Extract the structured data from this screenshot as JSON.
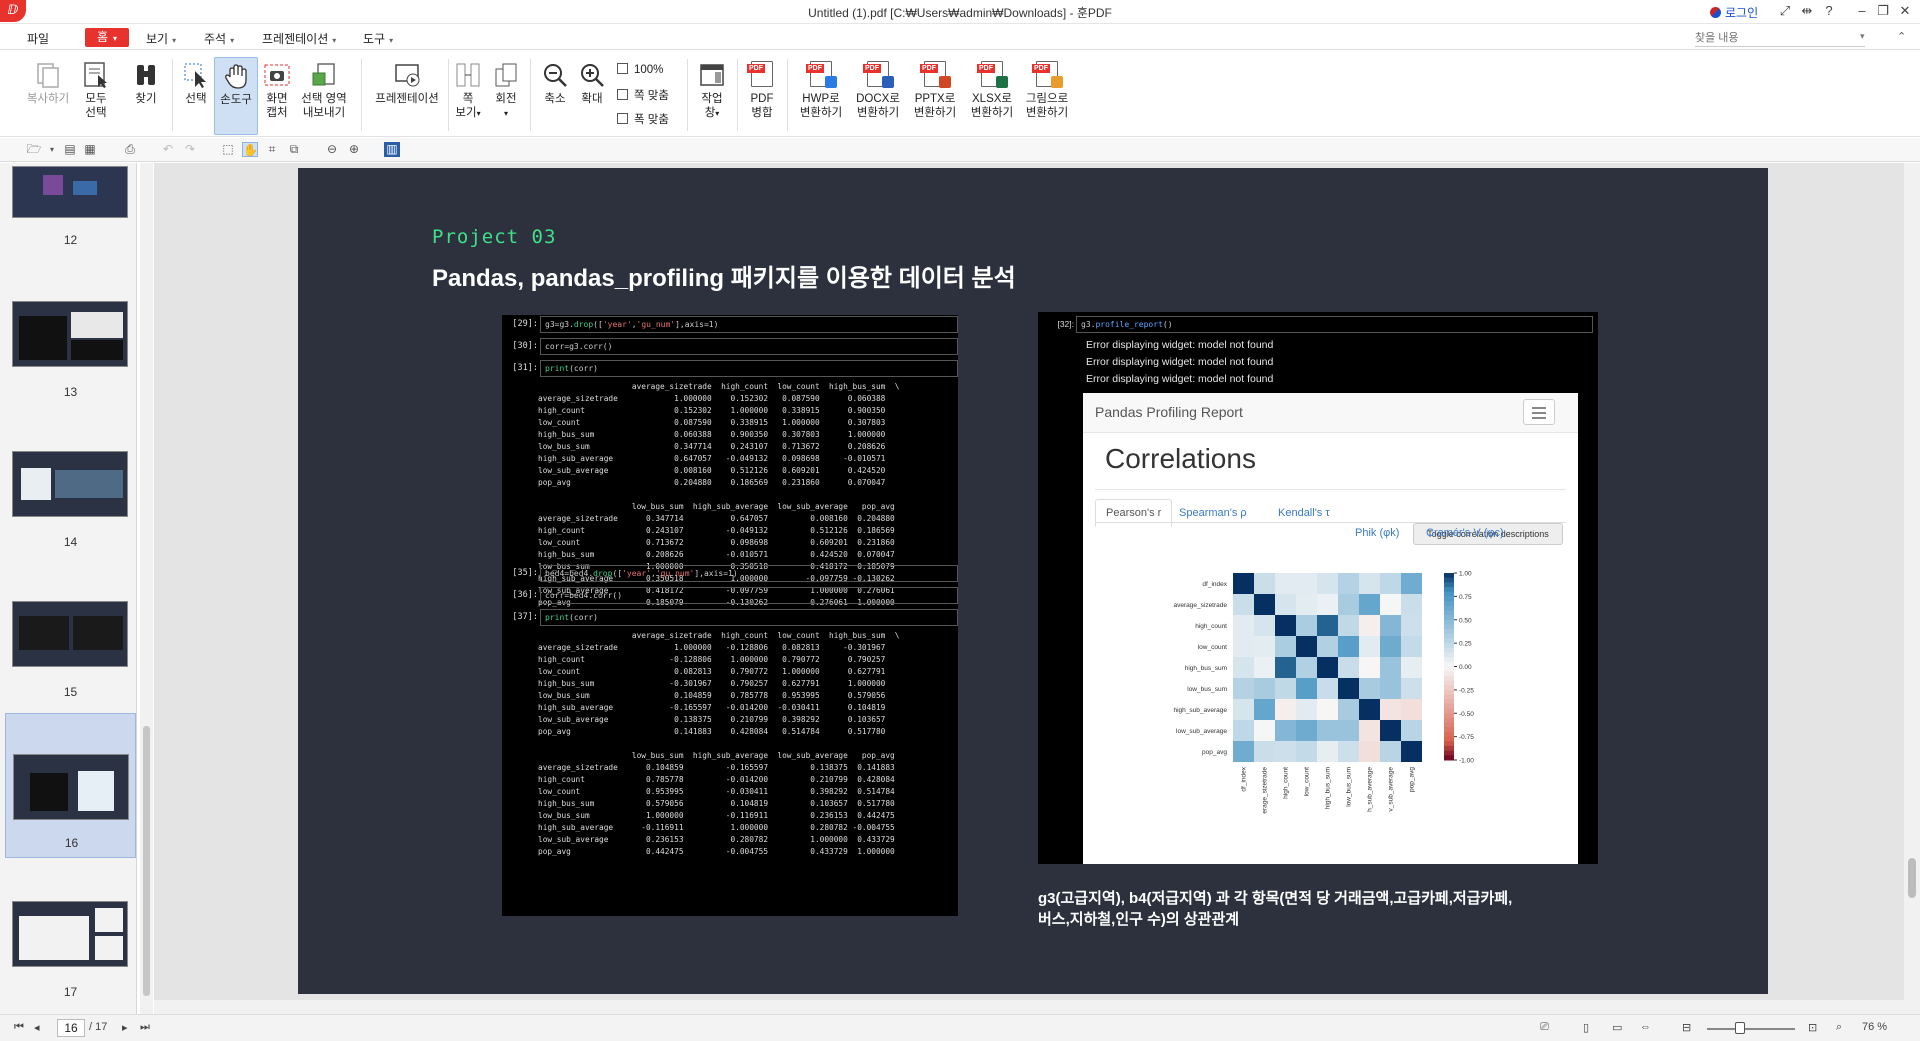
{
  "window": {
    "title": "Untitled (1).pdf [C:₩Users₩admin₩Downloads] - 훈PDF",
    "login": "로그인"
  },
  "menu": {
    "file": "파일",
    "home": "홈",
    "view": "보기",
    "annotation": "주석",
    "presentation": "프레젠테이션",
    "tools": "도구",
    "search_placeholder": "찾을 내용"
  },
  "ribbon": {
    "copy": "복사하기",
    "select_all_1": "모두",
    "select_all_2": "선택",
    "find": "찾기",
    "select": "선택",
    "hand": "손도구",
    "capture_1": "화면",
    "capture_2": "캡처",
    "export_area_1": "선택 영역",
    "export_area_2": "내보내기",
    "presentation": "프레젠테이션",
    "page_view_1": "쪽",
    "page_view_2": "보기",
    "rotate_1": "회전",
    "zoom_out": "축소",
    "zoom_in": "확대",
    "zoom_100": "100%",
    "fit_page": "쪽 맞춤",
    "fit_width": "폭 맞춤",
    "window_1": "작업",
    "window_2": "창",
    "merge_1": "PDF",
    "merge_2": "병합",
    "to_hwp_1": "HWP로",
    "to_hwp_2": "변환하기",
    "to_docx_1": "DOCX로",
    "to_docx_2": "변환하기",
    "to_pptx_1": "PPTX로",
    "to_pptx_2": "변환하기",
    "to_xlsx_1": "XLSX로",
    "to_xlsx_2": "변환하기",
    "to_img_1": "그림으로",
    "to_img_2": "변환하기"
  },
  "sidebar": {
    "pages": [
      "12",
      "13",
      "14",
      "15",
      "16",
      "17"
    ],
    "selected": "16"
  },
  "slide": {
    "project": "Project 03",
    "heading": "Pandas, pandas_profiling 패키지를 이용한 데이터 분석",
    "caption_1": "g3(고급지역), b4(저급지역) 과 각 항목(면적 당 거래금액,고급카페,저급카페,",
    "caption_2": "버스,지하철,인구 수)의 상관관계"
  },
  "notebook_left": {
    "c29_prompt": "[29]:",
    "c29_a": "g3=g3.",
    "c29_b": "drop",
    "c29_c": "([",
    "c29_d": "'year'",
    "c29_e": ",",
    "c29_f": "'gu_num'",
    "c29_g": "],axis=1)",
    "c30_prompt": "[30]:",
    "c30_code": "corr=g3.corr()",
    "c31_prompt": "[31]:",
    "c31_a": "print",
    "c31_b": "(corr)",
    "out1": "                    average_sizetrade  high_count  low_count  high_bus_sum  \\\naverage_sizetrade            1.000000    0.152302   0.087590      0.060388\nhigh_count                   0.152302    1.000000   0.338915      0.900350\nlow_count                    0.087590    0.338915   1.000000      0.307803\nhigh_bus_sum                 0.060388    0.900350   0.307803      1.000000\nlow_bus_sum                  0.347714    0.243107   0.713672      0.208626\nhigh_sub_average             0.647057   -0.049132   0.098698     -0.010571\nlow_sub_average              0.008160    0.512126   0.609201      0.424520\npop_avg                      0.204880    0.186569   0.231860      0.070047\n\n                    low_bus_sum  high_sub_average  low_sub_average   pop_avg\naverage_sizetrade      0.347714          0.647057         0.008160  0.204880\nhigh_count             0.243107         -0.049132         0.512126  0.186569\nlow_count              0.713672          0.098698         0.609201  0.231860\nhigh_bus_sum           0.208626         -0.010571         0.424520  0.070047\nlow_bus_sum            1.000000          0.350518         0.418172  0.185079\nhigh_sub_average       0.350518          1.000000        -0.097759 -0.130262\nlow_sub_average        0.418172         -0.097759         1.000000  0.276061\npop_avg                0.185079         -0.130262         0.276061  1.000000",
    "c35_prompt": "[35]:",
    "c35_a": "bed4=bed4.",
    "c35_b": "drop",
    "c35_c": "([",
    "c35_d": "'year'",
    "c35_e": ",",
    "c35_f": "'gu_num'",
    "c35_g": "],axis=1)",
    "c36_prompt": "[36]:",
    "c36_code": "corr=bed4.corr()",
    "c37_prompt": "[37]:",
    "c37_a": "print",
    "c37_b": "(corr)",
    "out2": "                    average_sizetrade  high_count  low_count  high_bus_sum  \\\naverage_sizetrade            1.000000   -0.128806   0.082813     -0.301967\nhigh_count                  -0.128806    1.000000   0.790772      0.790257\nlow_count                    0.082813    0.790772   1.000000      0.627791\nhigh_bus_sum                -0.301967    0.790257   0.627791      1.000000\nlow_bus_sum                  0.104859    0.785778   0.953995      0.579056\nhigh_sub_average            -0.165597   -0.014200  -0.030411      0.104819\nlow_sub_average              0.138375    0.210799   0.398292      0.103657\npop_avg                      0.141883    0.428084   0.514784      0.517780\n\n                    low_bus_sum  high_sub_average  low_sub_average   pop_avg\naverage_sizetrade      0.104859         -0.165597         0.138375  0.141883\nhigh_count             0.785778         -0.014200         0.210799  0.428084\nlow_count              0.953995         -0.030411         0.398292  0.514784\nhigh_bus_sum           0.579056          0.104819         0.103657  0.517780\nlow_bus_sum            1.000000         -0.116911         0.236153  0.442475\nhigh_sub_average      -0.116911          1.000000         0.280782 -0.004755\nlow_sub_average        0.236153          0.280782         1.000000  0.433729\npop_avg                0.442475         -0.004755         0.433729  1.000000"
  },
  "notebook_right": {
    "c32_prompt": "[32]:",
    "c32_a": "g3.",
    "c32_b": "profile_report",
    "c32_c": "()",
    "err1": "Error displaying widget: model not found",
    "err2": "Error displaying widget: model not found",
    "err3": "Error displaying widget: model not found",
    "report_title": "Pandas Profiling Report",
    "section": "Correlations",
    "tab_pearson": "Pearson's r",
    "tab_spearman": "Spearman's ρ",
    "tab_kendall": "Kendall's τ",
    "tab_phik": "Phik (φk)",
    "tab_cramers": "Cramér's V (φc)",
    "toggle": "Toggle correlation descriptions"
  },
  "chart_data": {
    "type": "heatmap",
    "rows": [
      "df_index",
      "average_sizetrade",
      "high_count",
      "low_count",
      "high_bus_sum",
      "low_bus_sum",
      "high_sub_average",
      "low_sub_average",
      "pop_avg"
    ],
    "cols": [
      "df_index",
      "average_sizetrade",
      "high_count",
      "low_count",
      "high_bus_sum",
      "low_bus_sum",
      "high_sub_average",
      "low_sub_average",
      "pop_avg"
    ],
    "col_labels": [
      "df_index",
      "erage_sizetrade",
      "high_count",
      "low_count",
      "high_bus_sum",
      "low_bus_sum",
      "h_sub_average",
      "v_sub_average",
      "pop_avg"
    ],
    "values": [
      [
        1.0,
        0.2,
        0.1,
        0.1,
        0.15,
        0.3,
        0.15,
        0.25,
        0.6
      ],
      [
        0.2,
        1.0,
        0.15,
        0.09,
        0.06,
        0.35,
        0.65,
        0.01,
        0.2
      ],
      [
        0.1,
        0.15,
        1.0,
        0.34,
        0.9,
        0.24,
        -0.05,
        0.51,
        0.19
      ],
      [
        0.1,
        0.09,
        0.34,
        1.0,
        0.31,
        0.71,
        0.1,
        0.61,
        0.23
      ],
      [
        0.15,
        0.06,
        0.9,
        0.31,
        1.0,
        0.21,
        -0.01,
        0.42,
        0.07
      ],
      [
        0.3,
        0.35,
        0.24,
        0.71,
        0.21,
        1.0,
        0.35,
        0.42,
        0.19
      ],
      [
        0.15,
        0.65,
        -0.05,
        0.1,
        -0.01,
        0.35,
        1.0,
        -0.1,
        -0.13
      ],
      [
        0.25,
        0.01,
        0.51,
        0.61,
        0.42,
        0.42,
        -0.1,
        1.0,
        0.28
      ],
      [
        0.6,
        0.2,
        0.19,
        0.23,
        0.07,
        0.19,
        -0.13,
        0.28,
        1.0
      ]
    ],
    "colorbar_ticks": [
      "1.00",
      "0.75",
      "0.50",
      "0.25",
      "0.00",
      "-0.25",
      "-0.50",
      "-0.75",
      "-1.00"
    ],
    "colorbar_values": [
      1.0,
      0.75,
      0.5,
      0.25,
      0.0,
      -0.25,
      -0.5,
      -0.75,
      -1.0
    ],
    "vmin": -1,
    "vmax": 1,
    "colormap": "RdBu"
  },
  "statusbar": {
    "page": "16",
    "total": "/ 17",
    "zoom": "76 %"
  },
  "colors": {
    "accent": "#e8322e",
    "selection": "#cfe0f5",
    "slide_bg": "#2c313d",
    "project_green": "#3ee08a"
  }
}
